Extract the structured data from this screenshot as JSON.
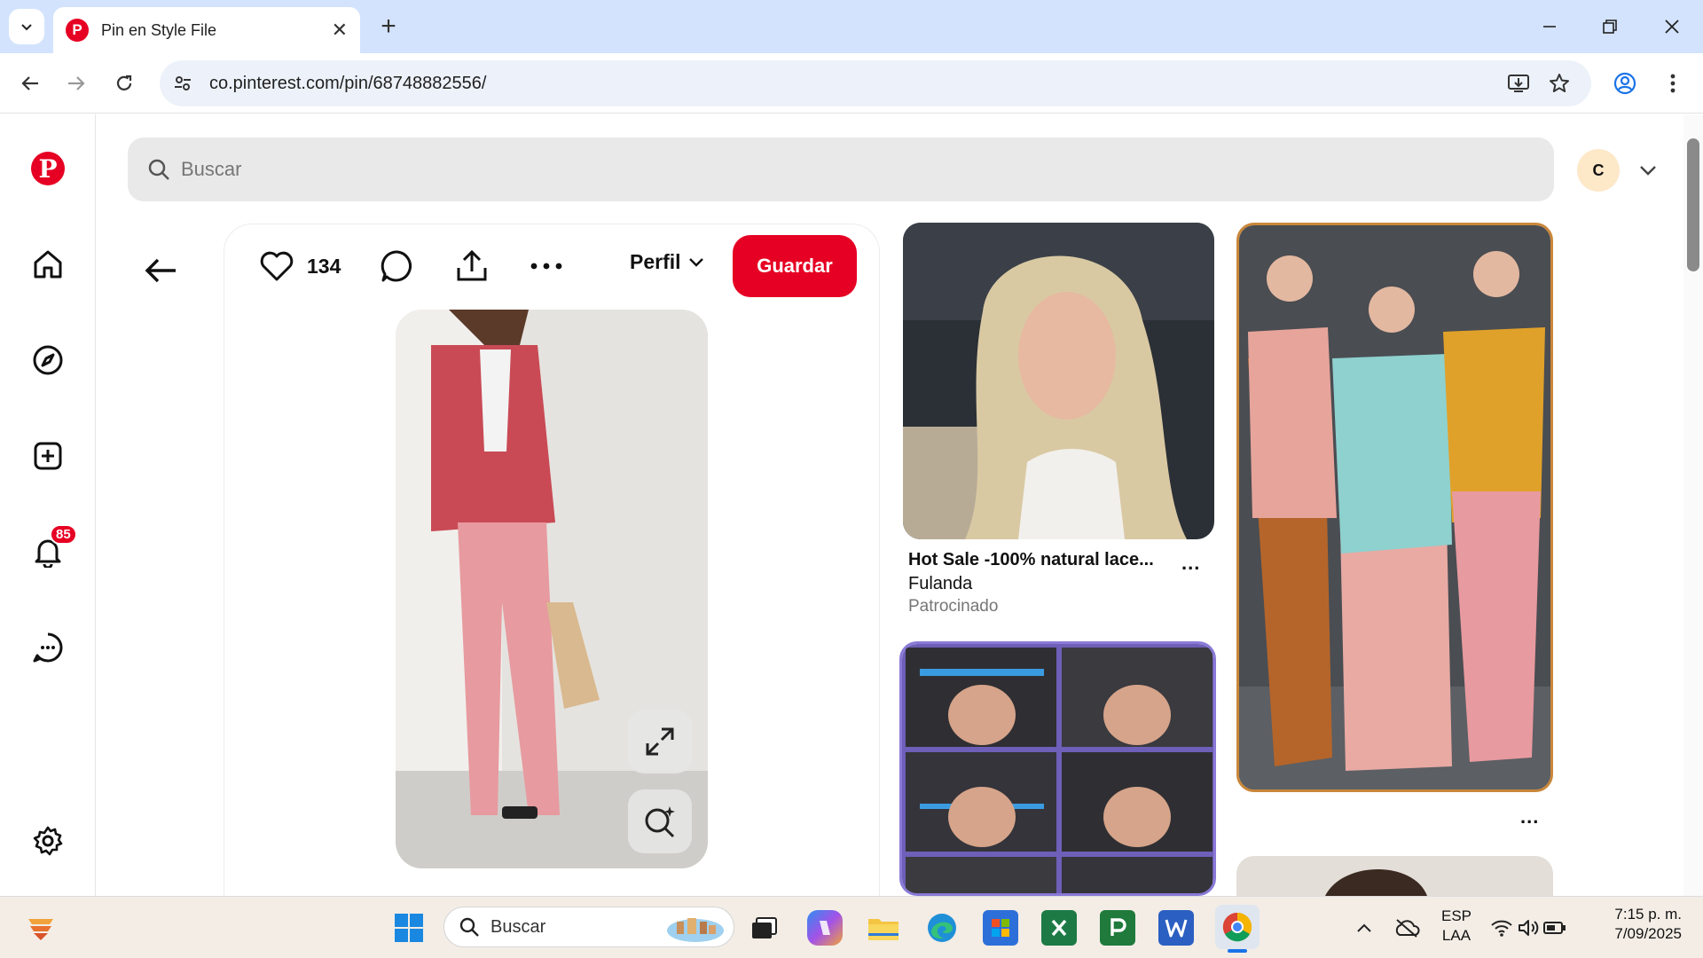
{
  "browser": {
    "tab_title": "Pin en Style File",
    "url": "co.pinterest.com/pin/68748882556/"
  },
  "pinterest": {
    "logo": "P",
    "search_placeholder": "Buscar",
    "avatar_initial": "C",
    "notifications_count": "85",
    "rail_items": [
      "pinterest-logo",
      "home-icon",
      "explore-icon",
      "create-icon",
      "notifications-icon",
      "messages-icon",
      "settings-icon"
    ]
  },
  "pin": {
    "likes": "134",
    "profile_label": "Perfil",
    "save_label": "Guardar"
  },
  "feed": {
    "card1_title": "Hot Sale -100% natural lace...",
    "card1_advertiser": "Fulanda",
    "card1_sponsored": "Patrocinado",
    "more_label": "..."
  },
  "taskbar": {
    "search_placeholder": "Buscar",
    "lang_top": "ESP",
    "lang_bottom": "LAA",
    "time": "7:15 p. m.",
    "date": "7/09/2025"
  },
  "colors": {
    "pinterest_red": "#e60023",
    "tabstrip": "#d3e3fd",
    "omnibox": "#edf2fa",
    "search_bg": "#e9e9e9"
  }
}
